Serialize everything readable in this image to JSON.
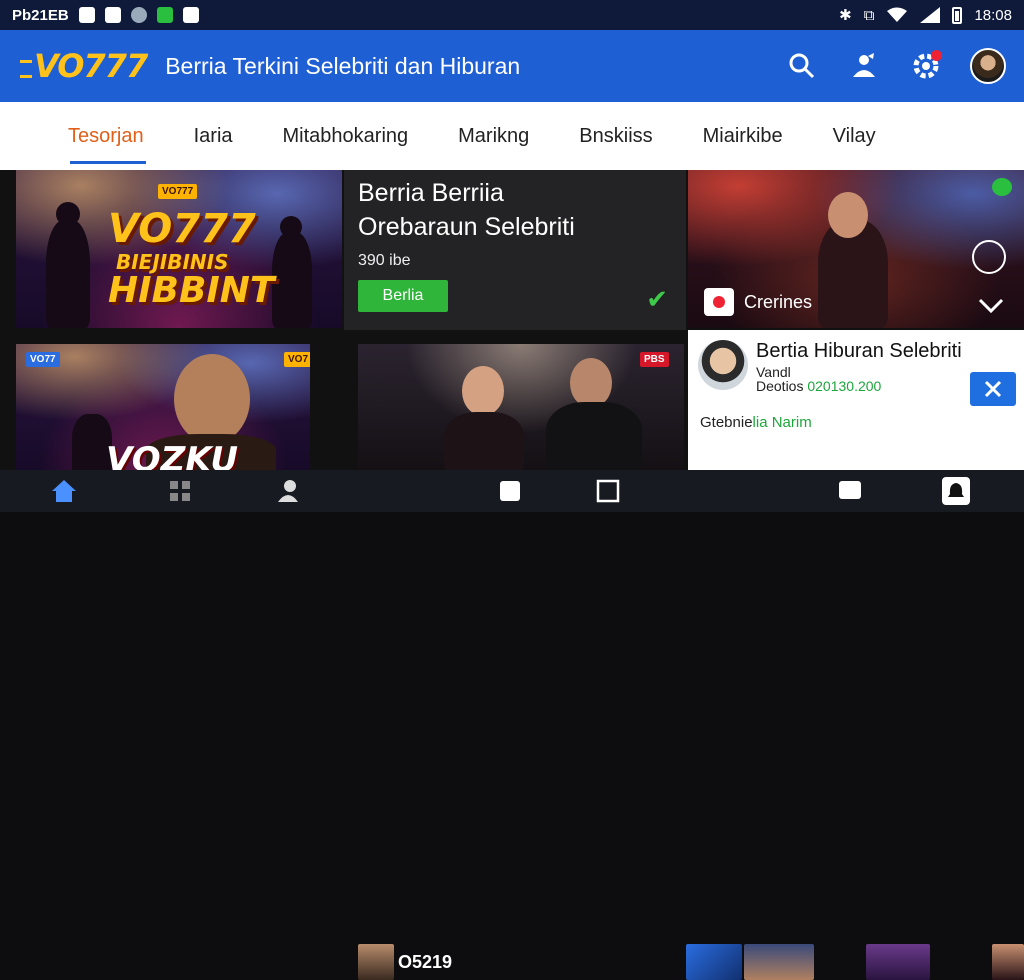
{
  "status_bar": {
    "carrier_text": "Pb21EB",
    "time": "18:08"
  },
  "app_bar": {
    "logo": "VO777",
    "title": "Berria Terkini Selebriti dan Hiburan"
  },
  "tabs": [
    {
      "label": "Tesorjan",
      "active": true
    },
    {
      "label": "Iaria",
      "active": false
    },
    {
      "label": "Mitabhokaring",
      "active": false
    },
    {
      "label": "Marikng",
      "active": false
    },
    {
      "label": "Bnskiiss",
      "active": false
    },
    {
      "label": "Miairkibe",
      "active": false
    },
    {
      "label": "Vilay",
      "active": false
    }
  ],
  "feed": {
    "hero_left": {
      "logo_line1": "VO777",
      "logo_line2": "BIEJIBINIS",
      "logo_line3": "HIBBINT",
      "tag": "VO777"
    },
    "center_article": {
      "title_line1": "Berria Berriia",
      "title_line2": "Orebaraun Selebriti",
      "meta": "390 ibe",
      "button_label": "Berlia"
    },
    "hero_right": {
      "chip_label": "Crerines"
    },
    "bottom_left": {
      "logo_text": "VOZKU",
      "tag_left": "VO77",
      "tag_right": "VO7"
    },
    "bottom_center": {
      "tag": "PBS"
    },
    "news_card": {
      "title": "Bertia Hiburan Selebriti",
      "subtitle": "Vandl",
      "date_label": "Deotios",
      "date_value": "020130.200",
      "link_prefix": "Gtebnie",
      "link_highlight": "lia Narim"
    }
  },
  "nav_bar": {
    "mini_player_text": "O5219"
  },
  "colors": {
    "app_bar": "#1f5fd4",
    "accent": "#ffc21a",
    "active_tab": "#e0601a",
    "green": "#2fb53a"
  }
}
